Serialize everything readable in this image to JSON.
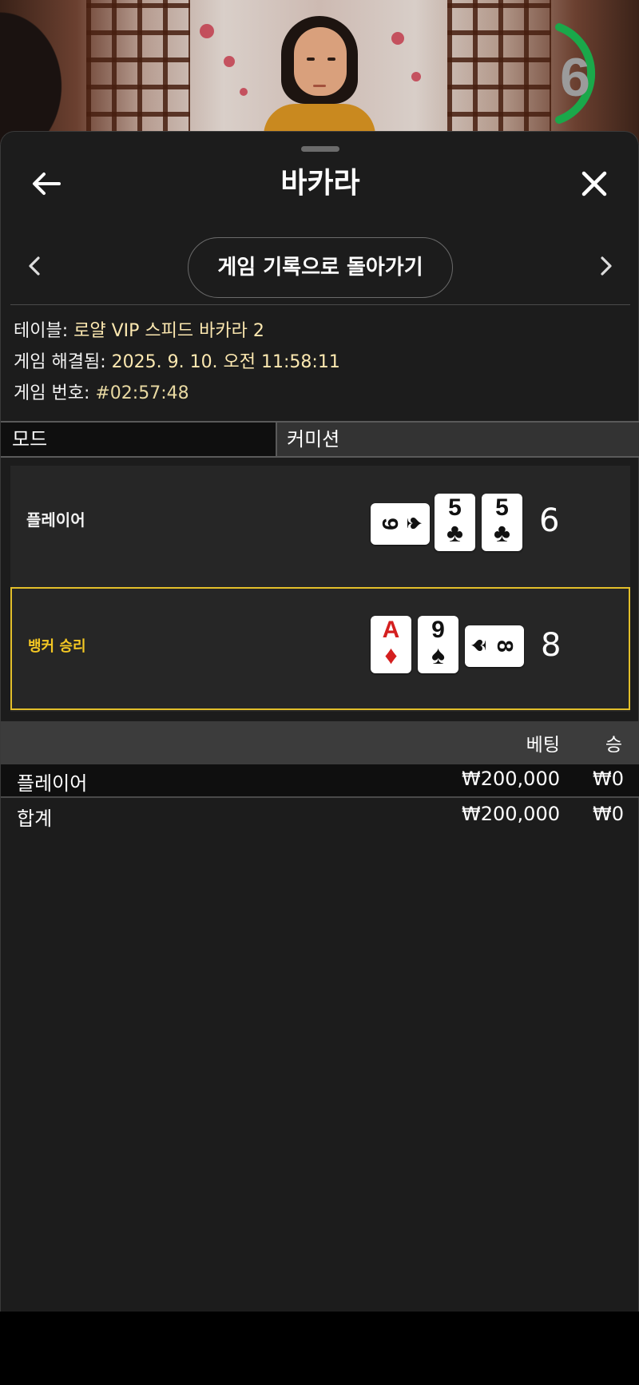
{
  "video": {
    "timer": "6"
  },
  "header": {
    "title": "바카라",
    "back_icon": "arrow-left-icon",
    "close_icon": "close-icon"
  },
  "nav": {
    "history_button": "게임 기록으로 돌아가기",
    "prev_icon": "chevron-left-icon",
    "next_icon": "chevron-right-icon"
  },
  "info": {
    "table_label": "테이블: ",
    "table_value": "로얄 VIP 스피드 바카라 2",
    "resolved_label": "게임 해결됨: ",
    "resolved_value": "2025. 9. 10. 오전 11:58:11",
    "game_no_label": "게임 번호: ",
    "game_no_value": "#02:57:48"
  },
  "mode": {
    "left": "모드",
    "right": "커미션"
  },
  "hands": {
    "player": {
      "label": "플레이어",
      "score": "6",
      "cards": [
        {
          "rank": "9",
          "suit": "♠",
          "color": "black",
          "orientation": "side"
        },
        {
          "rank": "5",
          "suit": "♣",
          "color": "black",
          "orientation": "upright"
        },
        {
          "rank": "5",
          "suit": "♣",
          "color": "black",
          "orientation": "upright"
        }
      ]
    },
    "banker": {
      "label": "뱅커 승리",
      "score": "8",
      "cards": [
        {
          "rank": "A",
          "suit": "♦",
          "color": "red",
          "orientation": "upright"
        },
        {
          "rank": "9",
          "suit": "♠",
          "color": "black",
          "orientation": "upright"
        },
        {
          "rank": "8",
          "suit": "♠",
          "color": "black",
          "orientation": "side"
        }
      ]
    }
  },
  "bets": {
    "col_bet": "베팅",
    "col_win": "승",
    "rows": [
      {
        "name": "플레이어",
        "bet": "₩200,000",
        "win": "₩0"
      },
      {
        "name": "합계",
        "bet": "₩200,000",
        "win": "₩0"
      }
    ]
  },
  "colors": {
    "accent_win": "#f5c823",
    "timer_ring": "#1aa84a",
    "sheet_bg": "#1c1c1c"
  }
}
